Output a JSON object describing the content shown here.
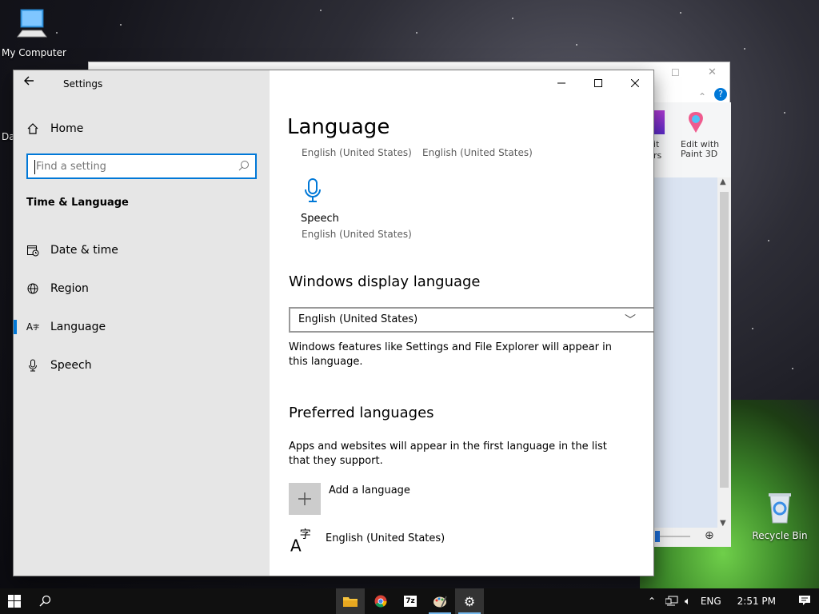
{
  "desktop": {
    "icons": [
      {
        "label": "My Computer"
      },
      {
        "label": "Recycle Bin"
      }
    ],
    "partial_label": "Da"
  },
  "background_window": {
    "ribbon_labels": [
      "it",
      "rs",
      "Edit with",
      "Paint 3D"
    ]
  },
  "settings": {
    "app_title": "Settings",
    "home_label": "Home",
    "search_placeholder": "Find a setting",
    "section_title": "Time & Language",
    "nav": [
      {
        "label": "Date & time",
        "icon": "calendar-clock-icon"
      },
      {
        "label": "Region",
        "icon": "globe-icon"
      },
      {
        "label": "Language",
        "icon": "language-icon",
        "active": true
      },
      {
        "label": "Speech",
        "icon": "microphone-icon"
      }
    ],
    "window_controls": {
      "minimize": "—",
      "maximize": "☐",
      "close": "✕"
    },
    "main": {
      "title": "Language",
      "top_sub_1": "English (United States)",
      "top_sub_2": "English (United States)",
      "speech_label": "Speech",
      "speech_sub": "English (United States)",
      "display_heading": "Windows display language",
      "display_value": "English (United States)",
      "display_desc": "Windows features like Settings and File Explorer will appear in this language.",
      "preferred_heading": "Preferred languages",
      "preferred_desc": "Apps and websites will appear in the first language in the list that they support.",
      "add_language": "Add a language",
      "language_item": "English (United States)"
    }
  },
  "taskbar": {
    "lang": "ENG",
    "time": "2:51 PM",
    "accent": "#0078d7"
  }
}
